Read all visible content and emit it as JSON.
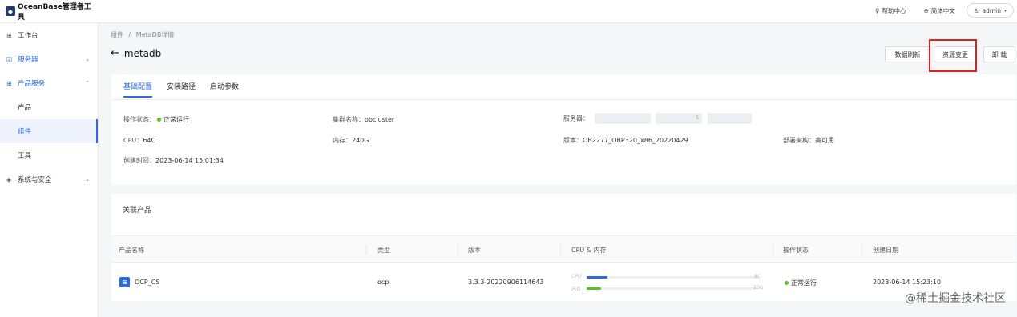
{
  "app": {
    "logo_text": "OceanBase管理者工具"
  },
  "topbar": {
    "help": "帮助中心",
    "language": "简体中文",
    "user": "admin"
  },
  "sidebar": {
    "items": [
      {
        "label": "工作台"
      },
      {
        "label": "服务器"
      },
      {
        "label": "产品服务"
      },
      {
        "label": "产品"
      },
      {
        "label": "组件"
      },
      {
        "label": "工具"
      },
      {
        "label": "系统与安全"
      }
    ]
  },
  "breadcrumb": {
    "root": "组件",
    "sep": "/",
    "current": "MetaDB详情"
  },
  "page": {
    "title": "metadb"
  },
  "actions": {
    "refresh": "数据刷新",
    "change": "资源变更",
    "uninstall": "卸 载"
  },
  "tabs": [
    {
      "label": "基础配置"
    },
    {
      "label": "安装路径"
    },
    {
      "label": "启动参数"
    }
  ],
  "info": {
    "status_label": "操作状态：",
    "status_value": "正常运行",
    "cluster_label": "集群名称：",
    "cluster_value": "obcluster",
    "server_label": "服务器：",
    "server_partial": "5",
    "cpu_label": "CPU：",
    "cpu_value": "64C",
    "mem_label": "内存：",
    "mem_value": "240G",
    "version_label": "版本：",
    "version_value": "OB2277_OBP320_x86_20220429",
    "deploy_label": "部署架构：",
    "deploy_value": "高可用",
    "created_label": "创建时间：",
    "created_value": "2023-06-14 15:01:34"
  },
  "related": {
    "title": "关联产品",
    "columns": [
      "产品名称",
      "类型",
      "版本",
      "CPU & 内存",
      "操作状态",
      "创建日期"
    ],
    "rows": [
      {
        "name": "OCP_CS",
        "type": "ocp",
        "version": "3.3.3-20220906114643",
        "cpu_label": "CPU",
        "cpu_total": "8C",
        "cpu_fraction": 0.03,
        "mem_label": "内存",
        "mem_total": "20G",
        "mem_fraction": 0.025,
        "status": "正常运行",
        "created": "2023-06-14 15:23:10"
      }
    ]
  },
  "colors": {
    "accent": "#2d6cdf",
    "success": "#52c41a",
    "mem_bar": "#52c41a",
    "highlight": "#e02020"
  },
  "watermark": "@稀土掘金技术社区"
}
